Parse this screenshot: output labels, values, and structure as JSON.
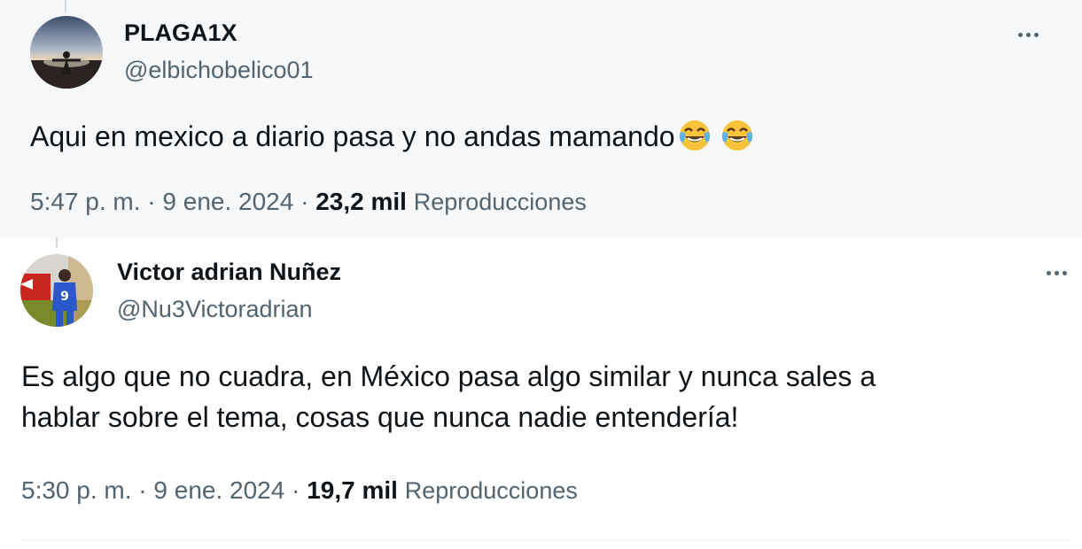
{
  "tweets": [
    {
      "display_name": "PLAGA1X",
      "handle": "@elbichobelico01",
      "text": "Aqui en mexico a diario pasa y no andas mamando",
      "emoji": [
        "face-with-tears-of-joy",
        "face-with-tears-of-joy"
      ],
      "time": "5:47 p. m.",
      "date": "9 ene. 2024",
      "views": "23,2 mil",
      "views_label": "Reproducciones",
      "separator": "·"
    },
    {
      "display_name": "Victor adrian Nuñez",
      "handle": "@Nu3Victoradrian",
      "text_lines": [
        "Es algo que no cuadra, en México pasa algo similar y nunca sales a",
        "hablar sobre el tema, cosas que nunca nadie entendería!"
      ],
      "time": "5:30 p. m.",
      "date": "9 ene. 2024",
      "views": "19,7 mil",
      "views_label": "Reproducciones",
      "separator": "·"
    }
  ],
  "colors": {
    "primary_text": "#0f1419",
    "secondary_text": "#536471",
    "panel_background": "#f7f8f9",
    "thread_line": "#cfd9de"
  }
}
